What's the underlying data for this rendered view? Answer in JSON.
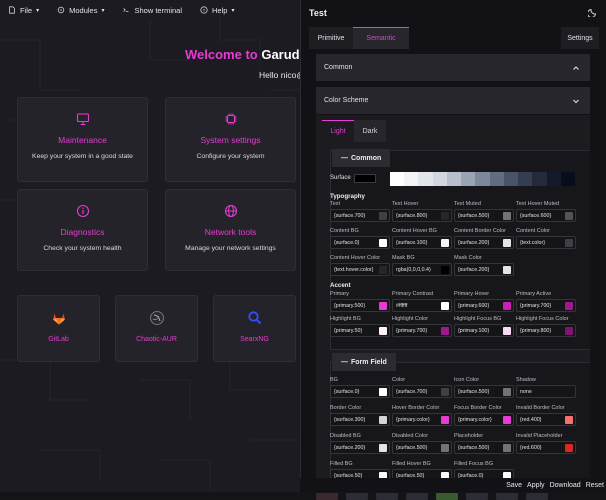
{
  "menubar": {
    "file": "File",
    "modules": "Modules",
    "show_terminal": "Show terminal",
    "help": "Help"
  },
  "welcome": {
    "prefix": "Welcome to ",
    "name": "Garuda",
    "hello": "Hello nico@"
  },
  "cards": [
    {
      "title": "Maintenance",
      "desc": "Keep your system in a good state",
      "icon": "monitor-icon"
    },
    {
      "title": "System settings",
      "desc": "Configure your system",
      "icon": "chip-icon"
    },
    {
      "title": "Diagnostics",
      "desc": "Check your system health",
      "icon": "info-icon"
    },
    {
      "title": "Network tools",
      "desc": "Manage your network settings",
      "icon": "globe-icon"
    }
  ],
  "small_cards": [
    {
      "title": "GitLab",
      "icon": "gitlab-icon"
    },
    {
      "title": "Chaotic-AUR",
      "icon": "chaotic-aur-icon"
    },
    {
      "title": "SearxNG",
      "icon": "searxng-icon"
    }
  ],
  "drawer": {
    "title": "Test",
    "tabs": [
      "Primitive",
      "Semantic"
    ],
    "active_tab": "Semantic",
    "settings_tab": "Settings",
    "accordions": {
      "common": "Common",
      "color_scheme": "Color Scheme"
    },
    "subtabs": [
      "Light",
      "Dark"
    ],
    "active_subtab": "Light",
    "common_section": {
      "legend": "Common",
      "surface_label": "Surface",
      "surface_scale": [
        "#ffffff",
        "#f1f3f6",
        "#e2e6ec",
        "#d1d6df",
        "#b8bfcc",
        "#9ba4b5",
        "#7e889c",
        "#636d82",
        "#4a5468",
        "#343d51",
        "#232a3c",
        "#131a2b",
        "#080d1c"
      ],
      "typography_label": "Typography",
      "typography": [
        {
          "label": "Text",
          "value": "{surface.700}",
          "swatch": "#3f3f46"
        },
        {
          "label": "Text Hover",
          "value": "{surface.800}",
          "swatch": "#27272a"
        },
        {
          "label": "Text Muted",
          "value": "{surface.500}",
          "swatch": "#71717a"
        },
        {
          "label": "Text Hover Muted",
          "value": "{surface.600}",
          "swatch": "#52525b"
        },
        {
          "label": "Content BG",
          "value": "{surface.0}",
          "swatch": "#ffffff"
        },
        {
          "label": "Content Hover BG",
          "value": "{surface.100}",
          "swatch": "#f4f4f5"
        },
        {
          "label": "Content Border Color",
          "value": "{surface.200}",
          "swatch": "#e4e4e7"
        },
        {
          "label": "Content Color",
          "value": "{text.color}",
          "swatch": "#3f3f46"
        },
        {
          "label": "Content Hover Color",
          "value": "{text.hover.color}",
          "swatch": "#27272a"
        },
        {
          "label": "Mask BG",
          "value": "rgba(0,0,0,0.4)",
          "swatch": "#000000"
        },
        {
          "label": "Mask Color",
          "value": "{surface.200}",
          "swatch": "#e4e4e7"
        }
      ],
      "accent_label": "Accent",
      "accent": [
        {
          "label": "Primary",
          "value": "{primary.500}",
          "swatch": "#e83bd4"
        },
        {
          "label": "Primary Contrast",
          "value": "#ffffff",
          "swatch": "#ffffff"
        },
        {
          "label": "Primary Hover",
          "value": "{primary.600}",
          "swatch": "#c91fb6"
        },
        {
          "label": "Primary Active",
          "value": "{primary.700}",
          "swatch": "#a1178f"
        },
        {
          "label": "Highlight BG",
          "value": "{primary.50}",
          "swatch": "#fdf0fb"
        },
        {
          "label": "Highlight Color",
          "value": "{primary.700}",
          "swatch": "#a1178f"
        },
        {
          "label": "Highlight Focus BG",
          "value": "{primary.100}",
          "swatch": "#f9d9f4"
        },
        {
          "label": "Highlight Focus Color",
          "value": "{primary.800}",
          "swatch": "#7f1471"
        }
      ]
    },
    "form_section": {
      "legend": "Form Field",
      "fields": [
        {
          "label": "BG",
          "value": "{surface.0}",
          "swatch": "#ffffff"
        },
        {
          "label": "Color",
          "value": "{surface.700}",
          "swatch": "#3f3f46"
        },
        {
          "label": "Icon Color",
          "value": "{surface.500}",
          "swatch": "#71717a"
        },
        {
          "label": "Shadow",
          "value": "none",
          "swatch": ""
        },
        {
          "label": "Border Color",
          "value": "{surface.300}",
          "swatch": "#d4d4d8"
        },
        {
          "label": "Hover Border Color",
          "value": "{primary.color}",
          "swatch": "#e83bd4"
        },
        {
          "label": "Focus Border Color",
          "value": "{primary.color}",
          "swatch": "#e83bd4"
        },
        {
          "label": "Invalid Border Color",
          "value": "{red.400}",
          "swatch": "#f87171"
        },
        {
          "label": "Disabled BG",
          "value": "{surface.200}",
          "swatch": "#e4e4e7"
        },
        {
          "label": "Disabled Color",
          "value": "{surface.500}",
          "swatch": "#71717a"
        },
        {
          "label": "Placeholder",
          "value": "{surface.500}",
          "swatch": "#71717a"
        },
        {
          "label": "Invalid Placeholder",
          "value": "{red.600}",
          "swatch": "#dc2626"
        },
        {
          "label": "Filled BG",
          "value": "{surface.50}",
          "swatch": "#fafafa"
        },
        {
          "label": "Filled Hover BG",
          "value": "{surface.50}",
          "swatch": "#fafafa"
        },
        {
          "label": "Filled Focus BG",
          "value": "{surface.0}",
          "swatch": "#ffffff"
        }
      ]
    },
    "footer": {
      "save": "Save",
      "apply": "Apply",
      "download": "Download",
      "reset": "Reset"
    }
  },
  "colors": {
    "accent": "#e83bd4",
    "bg": "#1c1b22",
    "panel": "#121216"
  }
}
